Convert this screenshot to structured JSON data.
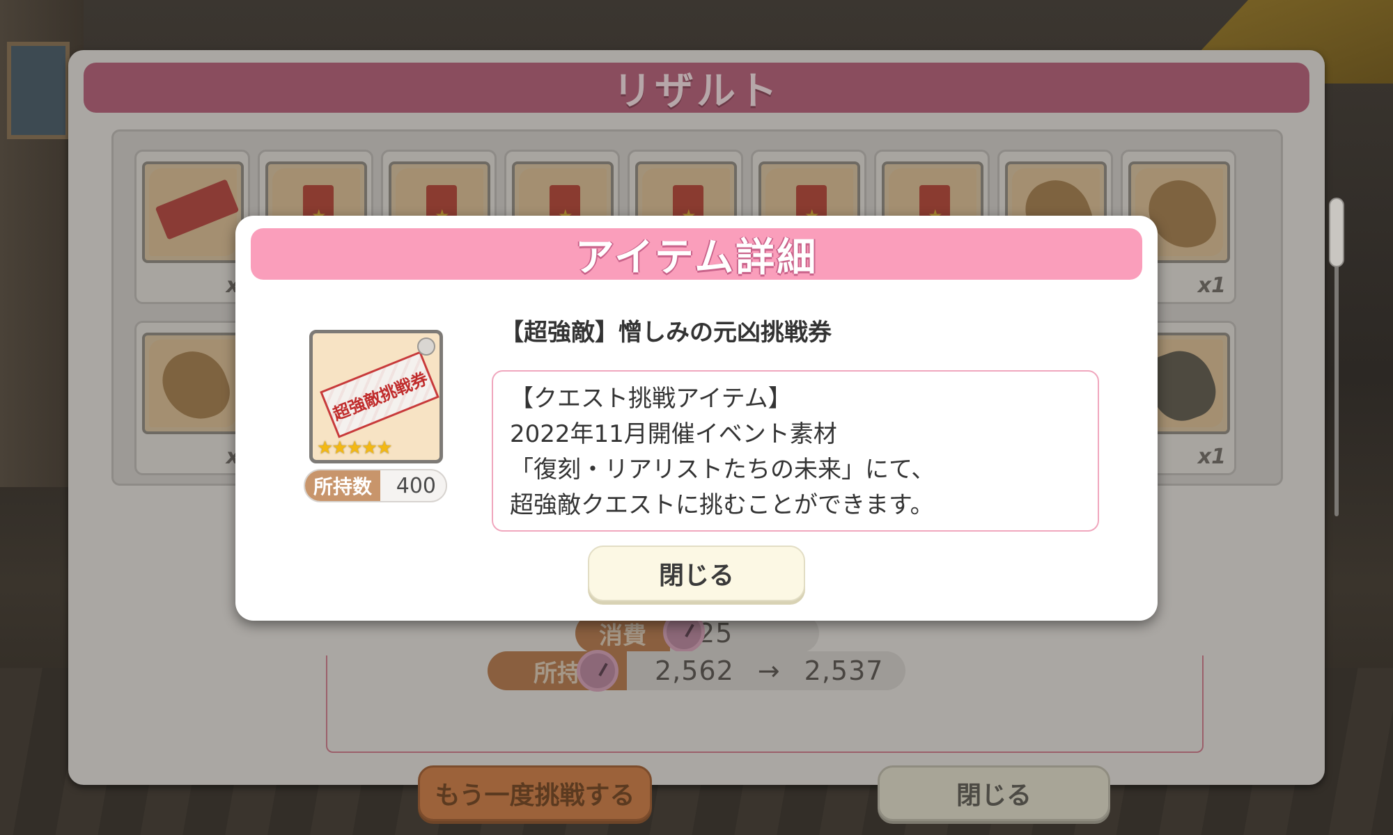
{
  "result": {
    "title": "リザルト",
    "items": [
      {
        "kind": "ticket",
        "qty": "x"
      },
      {
        "kind": "tag",
        "qty": ""
      },
      {
        "kind": "tag",
        "qty": ""
      },
      {
        "kind": "tag",
        "qty": ""
      },
      {
        "kind": "tag",
        "qty": ""
      },
      {
        "kind": "tag",
        "qty": ""
      },
      {
        "kind": "tag",
        "qty": ""
      },
      {
        "kind": "bread",
        "qty": ""
      },
      {
        "kind": "bread",
        "qty": "x1"
      }
    ],
    "row2": [
      {
        "kind": "bread",
        "qty": "x"
      },
      {
        "kind": "rock",
        "qty": "x1"
      }
    ],
    "stats": {
      "consume_label": "消費",
      "consume_value": "25",
      "owned_label": "所持",
      "owned_from": "2,562",
      "arrow": "→",
      "owned_to": "2,537"
    },
    "retry_button": "もう一度挑戦する",
    "close_button": "閉じる"
  },
  "detail": {
    "title": "アイテム詳細",
    "icon_ticket_text": "超強敵挑戦券",
    "icon_stars": "★★★★★",
    "owned_label": "所持数",
    "owned_value": "400",
    "item_name": "【超強敵】憎しみの元凶挑戦券",
    "description": [
      "【クエスト挑戦アイテム】",
      "2022年11月開催イベント素材",
      "「復刻・リアリストたちの未来」にて、",
      "超強敵クエストに挑むことができます。"
    ],
    "close_button": "閉じる"
  },
  "colors": {
    "dialog_header": "#fa9ebb",
    "result_header": "#8a4d5e",
    "owned_label_bg": "#c8956b",
    "desc_border": "#f0a6bd"
  }
}
